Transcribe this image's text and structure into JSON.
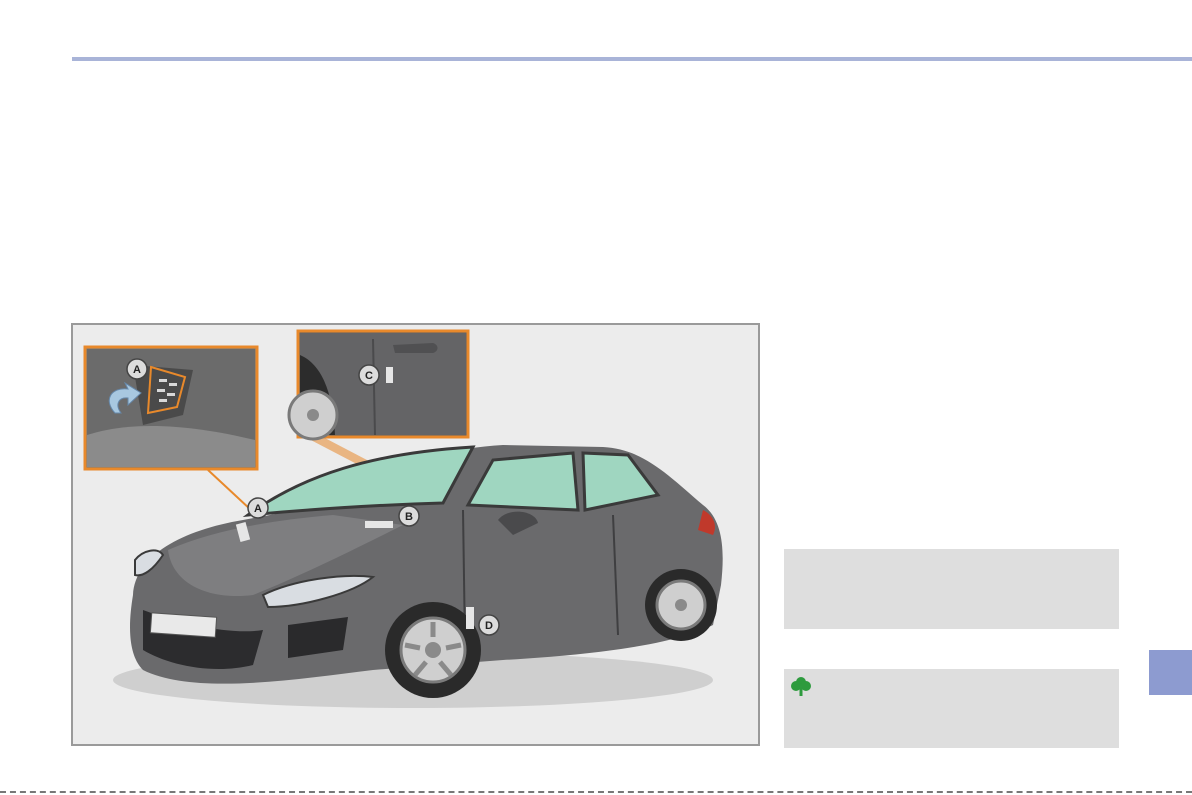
{
  "figure": {
    "callouts": {
      "a_inset": "A",
      "c_inset": "C",
      "a_car": "A",
      "b_car": "B",
      "d_car": "D"
    }
  },
  "colors": {
    "accent_rule": "#a9b4d8",
    "callout_orange": "#e8892b",
    "chapter_tab": "#8d9bd0",
    "eco_green": "#2e9b3e"
  },
  "icons": {
    "eco_note": "tree-icon"
  }
}
